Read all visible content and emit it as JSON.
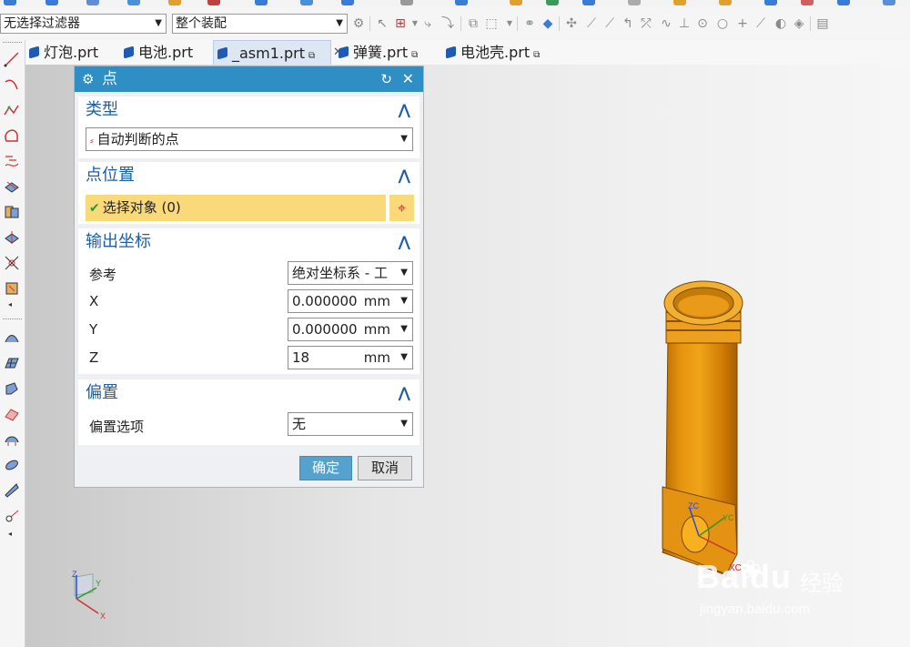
{
  "toolbar": {
    "filter_select": "无选择过滤器",
    "assembly_select": "整个装配"
  },
  "tabs": [
    {
      "label": "灯泡.prt",
      "active": false,
      "modified": false
    },
    {
      "label": "电池.prt",
      "active": false,
      "modified": false
    },
    {
      "label": "_asm1.prt",
      "active": true,
      "modified": true
    },
    {
      "label": "弹簧.prt",
      "active": false,
      "modified": true
    },
    {
      "label": "电池壳.prt",
      "active": false,
      "modified": true
    }
  ],
  "dialog": {
    "title": "点",
    "type_section": {
      "title": "类型",
      "value": "自动判断的点"
    },
    "position_section": {
      "title": "点位置",
      "select_label": "选择对象 (0)"
    },
    "output_section": {
      "title": "输出坐标",
      "reference_label": "参考",
      "reference_value": "绝对坐标系 - 工",
      "x_label": "X",
      "x_value": "0.000000",
      "y_label": "Y",
      "y_value": "0.000000",
      "z_label": "Z",
      "z_value": "18",
      "unit": "mm"
    },
    "offset_section": {
      "title": "偏置",
      "option_label": "偏置选项",
      "option_value": "无"
    },
    "ok_label": "确定",
    "cancel_label": "取消"
  },
  "viewport": {
    "axis_labels": {
      "z": "Z",
      "y": "Y",
      "x": "X",
      "xc": "XC",
      "yc": "YC",
      "zc": "ZC"
    }
  },
  "watermark": {
    "brand": "Baidu",
    "sub": "经验",
    "url": "jingyan.baidu.com"
  },
  "colors": {
    "title_bar": "#2f8ec4",
    "selection_highlight": "#fad97a",
    "ok_button": "#55a2cf",
    "part_color": "#e8940c"
  }
}
